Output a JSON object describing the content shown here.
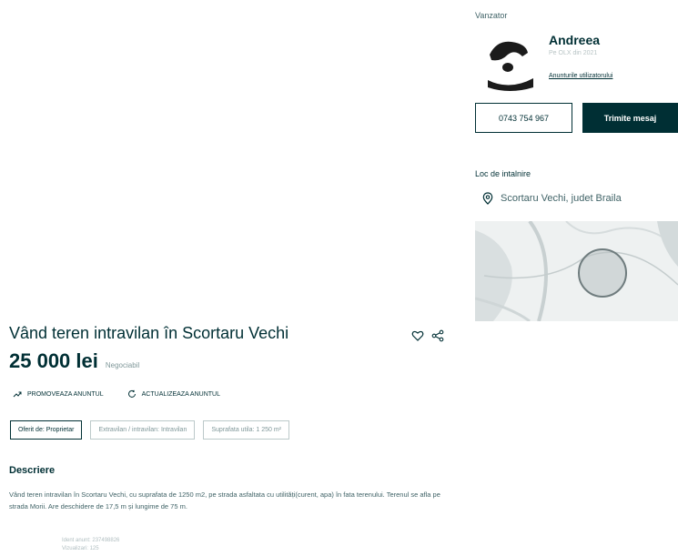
{
  "seller": {
    "heading": "Vanzator",
    "name": "Andreea",
    "since": "Pe OLX din 2021",
    "more_link": "Anunturile utilizatorului",
    "phone": "0743 754 967",
    "message_label": "Trimite mesaj"
  },
  "meeting": {
    "heading": "Loc de intalnire",
    "location": "Scortaru Vechi, judet Braila"
  },
  "listing": {
    "title": "Vând teren intravilan în Scortaru Vechi",
    "price": "25 000 lei",
    "negotiable": "Negociabil",
    "promote_label": "PROMOVEAZA ANUNTUL",
    "refresh_label": "ACTUALIZEAZA ANUNTUL",
    "tags": [
      "Oferit de: Proprietar",
      "Extravilan / intravilan: Intravilan",
      "Suprafata utila: 1 250 m²"
    ],
    "description_heading": "Descriere",
    "description": "Vând teren intravilan în Scortaru Vechi, cu suprafata de 1250 m2, pe strada asfaltata cu utilități(curent, apa) în fata terenului. Terenul se afla pe strada Morii. Are deschidere de 17,5 m și lungime de 75 m.",
    "meta_line1": "Ident anunt: 237498826",
    "meta_line2": "Vizualizari: 125"
  },
  "icons": {
    "favorite": "heart-icon",
    "share": "share-icon",
    "promote": "trend-up-icon",
    "refresh": "refresh-icon",
    "location": "location-pin-icon"
  },
  "colors": {
    "primary": "#002f34",
    "muted": "#406367",
    "map_circle": "#9aa6a8"
  }
}
